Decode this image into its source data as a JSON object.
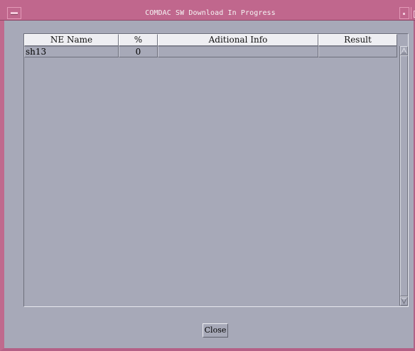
{
  "window": {
    "title": "COMDAC SW Download In Progress"
  },
  "table": {
    "columns": [
      {
        "label": "NE Name"
      },
      {
        "label": "%"
      },
      {
        "label": "Aditional Info"
      },
      {
        "label": "Result"
      }
    ],
    "rows": [
      {
        "ne_name": "sh13",
        "percent": "0",
        "info": "",
        "result": ""
      }
    ]
  },
  "footer": {
    "close_label": "Close"
  },
  "icons": {
    "window_menu": "window-menu-icon",
    "minimize": "minimize-icon",
    "maximize": "maximize-icon",
    "scroll_up": "arrow-up-icon",
    "scroll_down": "arrow-down-icon"
  },
  "colors": {
    "titlebar": "#c0678d",
    "background": "#a7a9b8",
    "header_bg": "#eeeef2"
  }
}
